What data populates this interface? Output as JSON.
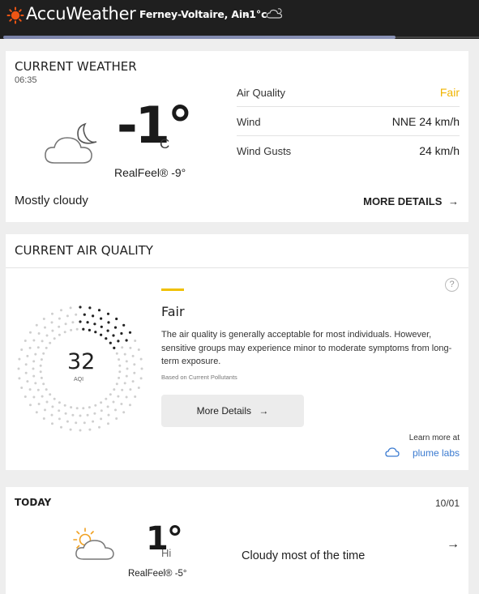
{
  "header": {
    "brand": "AccuWeather",
    "location": "Ferney-Voltaire, Ain",
    "temp": "-1°c",
    "condition_icon": "cloud-icon"
  },
  "current_weather": {
    "title": "CURRENT WEATHER",
    "time": "06:35",
    "icon": "cloudy-night-icon",
    "temp": "-1°",
    "unit": "C",
    "realfeel": "RealFeel® -9°",
    "phrase": "Mostly cloudy",
    "more_details": "MORE DETAILS",
    "details": [
      {
        "label": "Air Quality",
        "value": "Fair",
        "value_color": "#f0b400"
      },
      {
        "label": "Wind",
        "value": "NNE 24 km/h"
      },
      {
        "label": "Wind Gusts",
        "value": "24 km/h"
      }
    ]
  },
  "air_quality": {
    "title": "CURRENT AIR QUALITY",
    "aqi": "32",
    "aqi_label": "AQI",
    "aqi_fraction": 0.16,
    "category": "Fair",
    "category_color": "#f0c000",
    "description": "The air quality is generally acceptable for most individuals. However, sensitive groups may experience minor to moderate symptoms from long-term exposure.",
    "based_on": "Based on Current Pollutants",
    "button": "More Details",
    "help": "?",
    "learn_more": "Learn more at",
    "partner": "plume labs"
  },
  "today": {
    "title": "TODAY",
    "date": "10/01",
    "icon": "partly-cloudy-day-icon",
    "temp": "1°",
    "hi": "Hi",
    "realfeel": "RealFeel® -5°",
    "phrase": "Cloudy most of the time"
  }
}
